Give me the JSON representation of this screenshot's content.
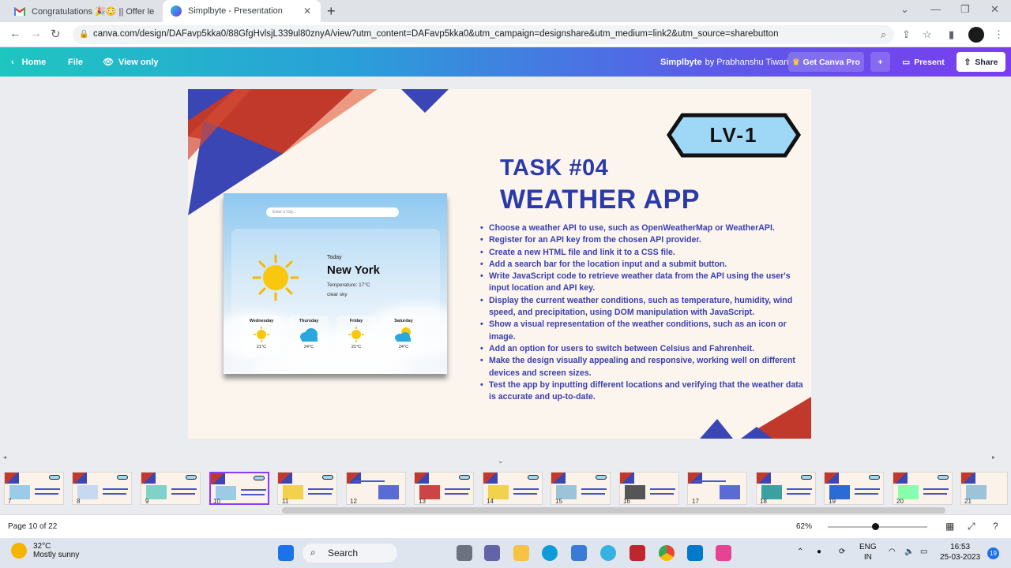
{
  "browser": {
    "tabs": [
      {
        "title": "Congratulations 🎉😳 || Offer le",
        "icon": "gmail-icon",
        "active": false
      },
      {
        "title": "Simplbyte - Presentation",
        "icon": "canva-icon",
        "active": true
      }
    ],
    "new_tab_label": "+",
    "url": "canva.com/design/DAFavp5kka0/88GfgHvlsjL339ul80znyA/view?utm_content=DAFavp5kka0&utm_campaign=designshare&utm_medium=link2&utm_source=sharebutton"
  },
  "canva_header": {
    "home_label": "Home",
    "file_label": "File",
    "view_only_label": "View only",
    "doc_title": "Simplbyte",
    "author_label": "by Prabhanshu Tiwari",
    "get_pro_label": "Get Canva Pro",
    "plus_label": "+",
    "present_label": "Present",
    "share_label": "Share"
  },
  "slide": {
    "level": "LV-1",
    "task_number": "TASK #04",
    "task_title": "WEATHER APP",
    "steps": [
      "Choose a weather API to use, such as OpenWeatherMap or WeatherAPI.",
      "Register for an API key from the chosen API provider.",
      "Create a new HTML file and link it to a CSS file.",
      "Add a search bar for the location input and a submit button.",
      "Write JavaScript code to retrieve weather data from the API using the user's input location and API key.",
      "Display the current weather conditions, such as temperature, humidity, wind speed, and precipitation, using DOM manipulation with JavaScript.",
      "Show a visual representation of the weather conditions, such as an icon or image.",
      "Add an option for users to switch between Celsius and Fahrenheit.",
      "Make the design visually appealing and responsive, working well on different devices and screen sizes.",
      "Test the app by inputting different locations and verifying that the weather data is accurate and up-to-date."
    ],
    "weather_preview": {
      "search_placeholder": "Enter a City...",
      "today_label": "Today",
      "city": "New York",
      "temperature": "Temperature: 17°C",
      "description": "clear sky",
      "forecast": [
        {
          "day": "Wednesday",
          "temp": "21°C",
          "icon": "sun-icon"
        },
        {
          "day": "Thursday",
          "temp": "24°C",
          "icon": "cloud-icon"
        },
        {
          "day": "Friday",
          "temp": "21°C",
          "icon": "sun-icon"
        },
        {
          "day": "Saturday",
          "temp": "24°C",
          "icon": "partly-cloudy-icon"
        }
      ]
    }
  },
  "filmstrip": {
    "pages": [
      "7",
      "8",
      "9",
      "10",
      "11",
      "12",
      "13",
      "14",
      "15",
      "16",
      "17",
      "18",
      "19",
      "20",
      "21"
    ],
    "selected_page": "10"
  },
  "footer": {
    "page_indicator": "Page 10 of 22",
    "zoom": "62%"
  },
  "taskbar": {
    "weather_temp": "32°C",
    "weather_desc": "Mostly sunny",
    "search_label": "Search",
    "language": "ENG",
    "region": "IN",
    "time": "16:53",
    "date": "25-03-2023",
    "notification_count": "19"
  }
}
